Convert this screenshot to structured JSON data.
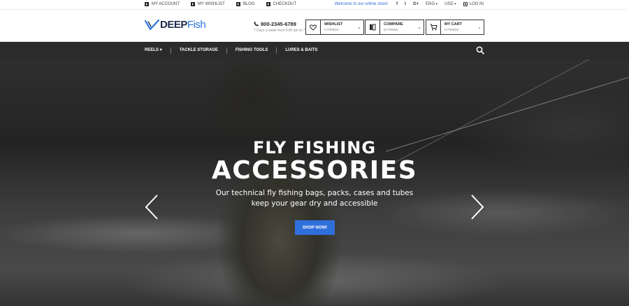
{
  "topbar": {
    "links": [
      "MY ACCOUNT",
      "MY WISHLIST",
      "BLOG",
      "CHECKOUT"
    ],
    "welcome": "Welcome to our online store!",
    "social": [
      "f",
      "t",
      "G+"
    ],
    "language": "ENG",
    "currency": "USD",
    "login": "LOG IN"
  },
  "header": {
    "logo_part1": "DEEP",
    "logo_part2": "Fish",
    "phone": "800-2345-6789",
    "hours": "7 Days a week from 9:00 am to 7:00 pm",
    "wishlist": {
      "title": "WISHLIST",
      "count": "0 ITEM(S)"
    },
    "compare": {
      "title": "COMPARE",
      "count": "(0 ITEMS)"
    },
    "cart": {
      "title": "MY CART",
      "count": "0 ITEM(S)"
    }
  },
  "nav": {
    "items": [
      "REELS",
      "TACKLE STORAGE",
      "FISHING TOOLS",
      "LURES & BAITS"
    ]
  },
  "hero": {
    "title1": "FLY FISHING",
    "title2": "ACCESSORIES",
    "subtitle": "Our technical fly fishing bags, packs, cases and tubes keep your gear dry and accessible",
    "button": "SHOP NOW!"
  },
  "colors": {
    "accent": "#2f6fdc",
    "nav_bg": "#2b2b2b",
    "logo_dark": "#1d2a4d"
  },
  "icons": [
    "play-square-icon",
    "heart-icon",
    "compare-icon",
    "cart-icon",
    "phone-icon",
    "search-icon",
    "chevron-left-icon",
    "chevron-right-icon",
    "login-icon"
  ]
}
